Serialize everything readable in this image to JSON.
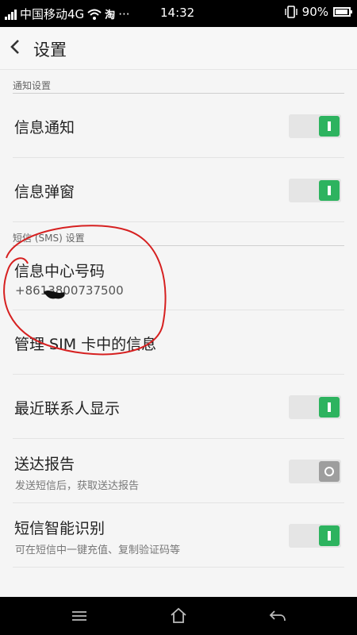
{
  "status_bar": {
    "carrier": "中国移动4G",
    "icons": [
      "signal-icon",
      "wifi-icon",
      "taobao-icon",
      "more-icon"
    ],
    "app_badge": "淘",
    "more": "···",
    "time": "14:32",
    "battery_percent": "90%",
    "battery_level": 0.9
  },
  "header": {
    "title": "设置",
    "back_icon": "chevron-left-icon"
  },
  "sections": {
    "notification": {
      "label": "通知设置",
      "items": {
        "notify": {
          "title": "信息通知",
          "toggle": true
        },
        "popup": {
          "title": "信息弹窗",
          "toggle": true
        }
      }
    },
    "sms": {
      "label": "短信 (SMS) 设置",
      "items": {
        "center": {
          "title": "信息中心号码",
          "subtitle": "+8613800737500"
        },
        "sim": {
          "title": "管理 SIM 卡中的信息"
        },
        "recent": {
          "title": "最近联系人显示",
          "toggle": true
        },
        "report": {
          "title": "送达报告",
          "subtitle": "发送短信后，获取送达报告",
          "toggle": false
        },
        "smart": {
          "title": "短信智能识别",
          "subtitle": "可在短信中一键充值、复制验证码等",
          "toggle": true
        }
      }
    }
  },
  "colors": {
    "toggle_on": "#2db35f",
    "toggle_off": "#9e9e9e",
    "annotation": "#d62020"
  },
  "nav_bar": {
    "icons": [
      "menu-icon",
      "home-icon",
      "back-icon"
    ]
  }
}
